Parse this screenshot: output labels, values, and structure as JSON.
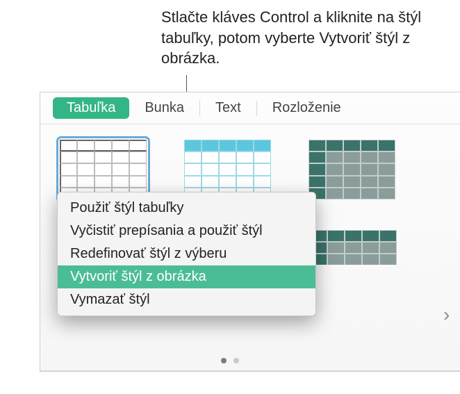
{
  "caption": "Stlačte kláves Control a kliknite na štýl tabuľky, potom vyberte Vytvoriť štýl z obrázka.",
  "tabs": {
    "table": "Tabuľka",
    "cell": "Bunka",
    "text": "Text",
    "layout": "Rozloženie"
  },
  "context_menu": {
    "items": [
      "Použiť štýl tabuľky",
      "Vyčistiť prepísania a použiť štýl",
      "Redefinovať štýl z výberu",
      "Vytvoriť štýl z obrázka",
      "Vymazať štýl"
    ],
    "highlighted_index": 3
  },
  "chevron_glyph": "›"
}
